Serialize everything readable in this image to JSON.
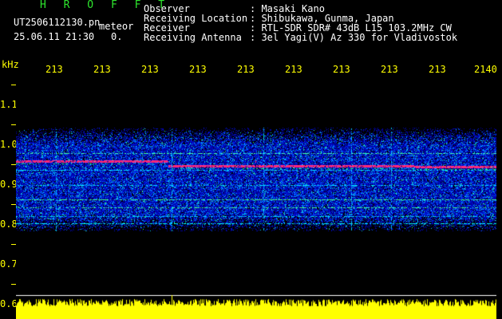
{
  "header": {
    "app_name": "H R O F F T",
    "filename": "UT2506112130.pn",
    "meteor_label": "meteor",
    "datetime": "25.06.11 21:30",
    "count": "0.",
    "fields": [
      {
        "label": "Observer",
        "value": ": Masaki Kano"
      },
      {
        "label": "Receiving Location",
        "value": ": Shibukawa, Gunma, Japan"
      },
      {
        "label": "Receiver",
        "value": ": RTL-SDR SDR# 43dB L15 103.2MHz CW"
      },
      {
        "label": "Receiving Antenna",
        "value": ": 3el Yagi(V) Az 330 for Vladivostok"
      }
    ]
  },
  "axes": {
    "y_unit": "kHz",
    "y_labels": [
      "1.1",
      "1.0",
      "0.9",
      "0.8",
      "0.7",
      "0.6"
    ],
    "x_labels": [
      "213",
      "213",
      "213",
      "213",
      "213",
      "213",
      "213",
      "213",
      "213",
      "2140"
    ]
  },
  "colors": {
    "header_green": "#2ee62e",
    "text_white": "#ffffff",
    "axis_yellow": "#ffff00",
    "trace_red": "#ff2060"
  }
}
